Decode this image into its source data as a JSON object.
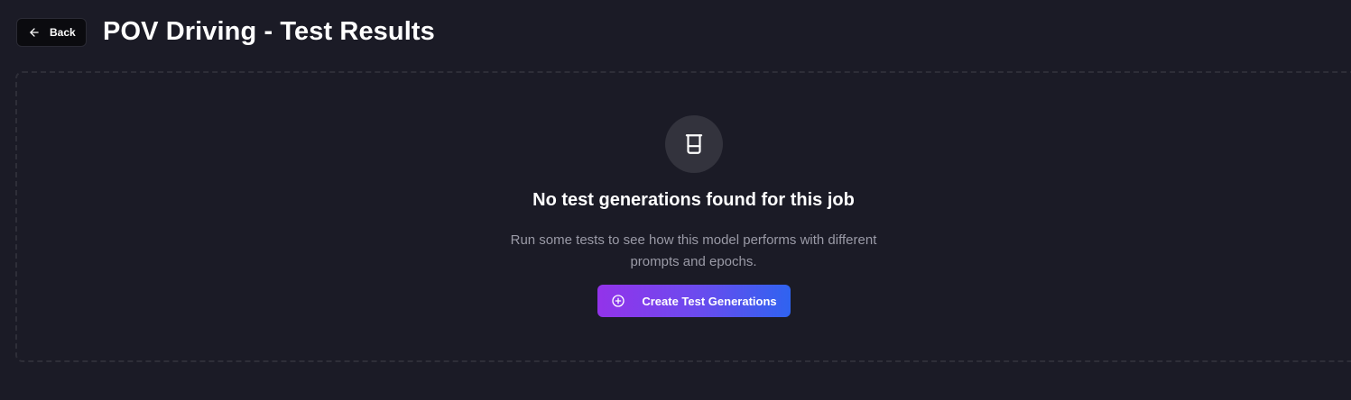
{
  "header": {
    "back_label": "Back",
    "back_icon": "arrow-left-icon",
    "title": "POV Driving - Test Results"
  },
  "empty_state": {
    "icon": "beaker-icon",
    "title": "No test generations found for this job",
    "description_line1": "Run some tests to see how this model performs with different",
    "description_line2": "prompts and epochs.",
    "button_label": "Create Test Generations",
    "button_icon": "plus-circle-icon"
  },
  "colors": {
    "background": "#1b1b26",
    "button_gradient_start": "#9333ea",
    "button_gradient_end": "#2f63f0"
  }
}
